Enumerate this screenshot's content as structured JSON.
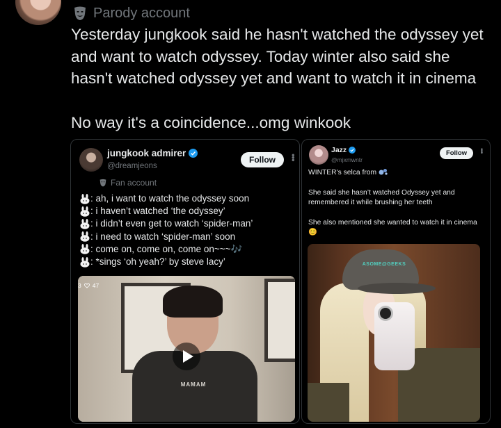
{
  "tweet": {
    "label": "Parody account",
    "text_line1": "Yesterday jungkook said he hasn't watched the odyssey yet and want to watch odyssey. Today winter also said she hasn't watched odyssey yet and want to watch it in cinema",
    "text_line2": "No way it's a coincidence...omg winkook"
  },
  "left_card": {
    "name": "jungkook admirer",
    "handle": "@dreamjeons",
    "follow": "Follow",
    "account_type": "Fan account",
    "lines": [
      ": ah, i want to watch the odyssey soon",
      ": i haven’t watched ‘the odyssey’",
      ": i didn’t even get to watch ‘spider-man’",
      ": i need to watch ‘spider-man’ soon",
      ": come on, come on, come on~~~🎶",
      ": *sings ‘oh yeah?’ by steve lacy’"
    ],
    "video": {
      "stat_left": "3",
      "likes": "47",
      "shirt_text": "MAMAM"
    }
  },
  "right_card": {
    "name": "Jazz",
    "handle": "@mjxmwntr",
    "follow": "Follow",
    "text1": "WINTER's selca from",
    "text2": "She said she hasn’t watched Odyssey yet and remembered it while brushing her teeth",
    "text3": "She also mentioned she wanted to watch it in cinema 😊",
    "hat_text": "ASOME@GEEKS"
  },
  "colors": {
    "background": "#000000",
    "text": "#e7e9ea",
    "muted": "#71767b",
    "border": "#2f3336",
    "verified": "#1d9bf0"
  }
}
